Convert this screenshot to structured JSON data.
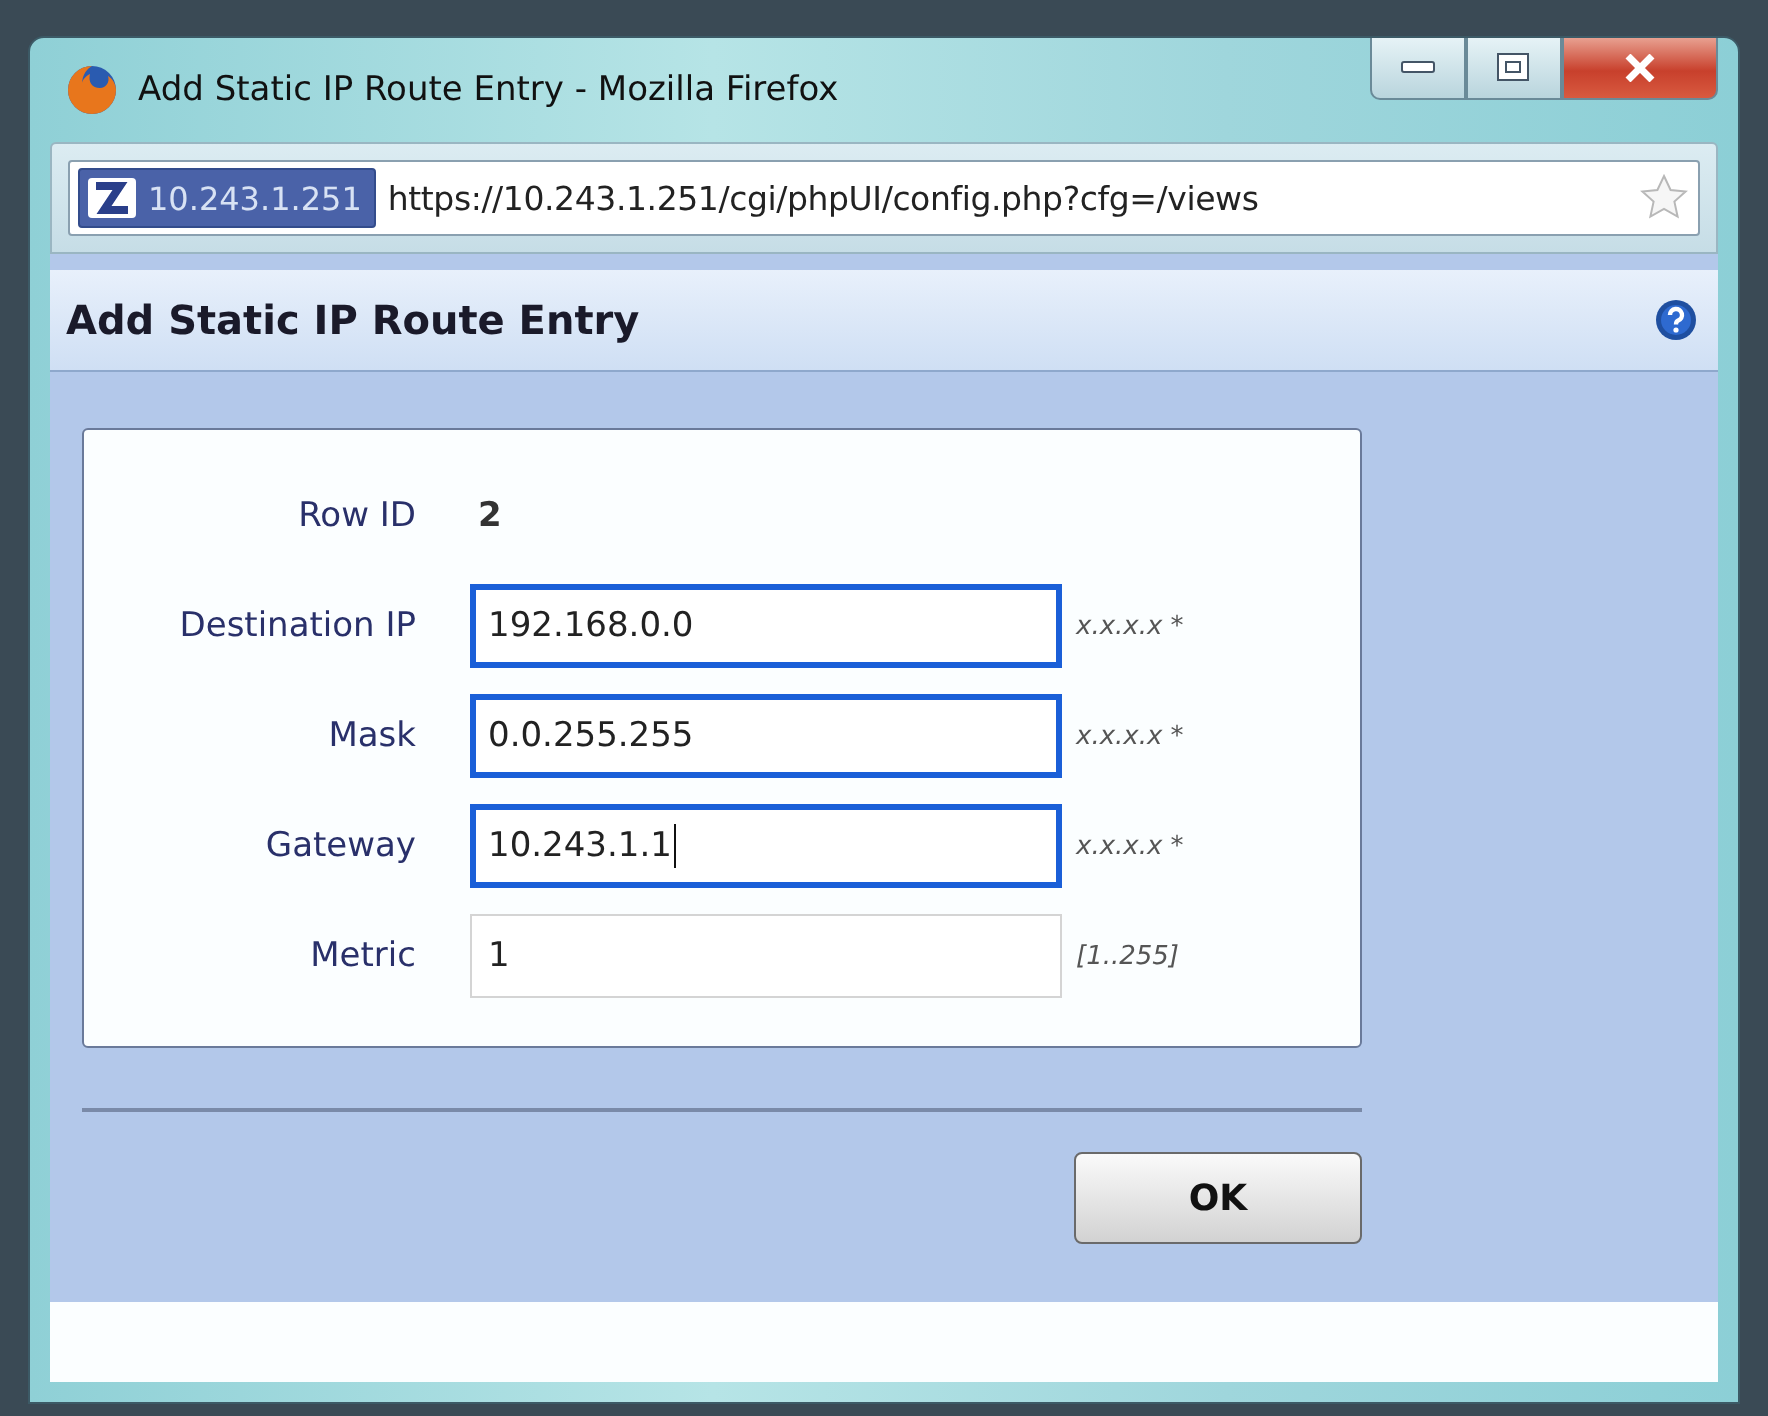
{
  "window": {
    "title": "Add Static IP Route Entry - Mozilla Firefox"
  },
  "url_bar": {
    "identity": "10.243.1.251",
    "url": "https://10.243.1.251/cgi/phpUI/config.php?cfg=/views"
  },
  "dialog": {
    "title": "Add Static IP Route Entry"
  },
  "rows": [
    {
      "kind": "text",
      "label": "Row ID",
      "value": "2"
    },
    {
      "kind": "field",
      "label": "Destination IP",
      "value": "192.168.0.0",
      "hint": "x.x.x.x *",
      "highlighted": true,
      "caret": false
    },
    {
      "kind": "field",
      "label": "Mask",
      "value": "0.0.255.255",
      "hint": "x.x.x.x *",
      "highlighted": true,
      "caret": false
    },
    {
      "kind": "field",
      "label": "Gateway",
      "value": "10.243.1.1",
      "hint": "x.x.x.x *",
      "highlighted": true,
      "caret": true
    },
    {
      "kind": "field",
      "label": "Metric",
      "value": "1",
      "hint": "[1..255]",
      "highlighted": false,
      "caret": false
    }
  ],
  "buttons": [
    "OK"
  ]
}
